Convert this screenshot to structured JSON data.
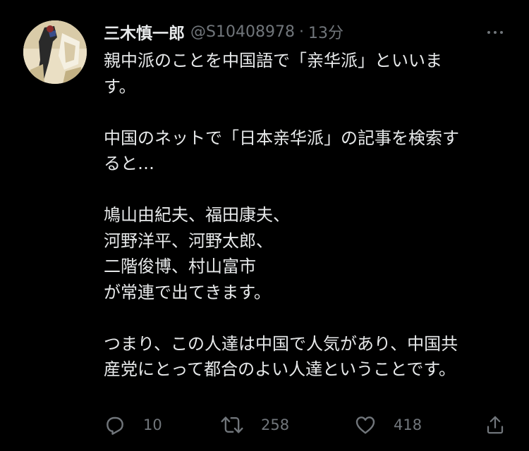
{
  "tweet": {
    "display_name": "三木慎一郎",
    "handle": "@S10408978",
    "separator": "·",
    "time": "13分",
    "more_icon": "more-horizontal-icon",
    "lines": [
      "親中派のことを中国語で「亲华派」といいま",
      "す。",
      "",
      "中国のネットで「日本亲华派」の記事を検索す",
      "ると…",
      "",
      "鳩山由紀夫、福田康夫、",
      "河野洋平、河野太郎、",
      "二階俊博、村山富市",
      "が常連で出てきます。",
      "",
      "つまり、この人達は中国で人気があり、中国共",
      "産党にとって都合のよい人達ということです。"
    ],
    "actions": {
      "reply": {
        "icon": "reply-icon",
        "count": "10"
      },
      "retweet": {
        "icon": "retweet-icon",
        "count": "258"
      },
      "like": {
        "icon": "heart-icon",
        "count": "418"
      },
      "share": {
        "icon": "share-icon",
        "count": ""
      }
    }
  },
  "colors": {
    "background": "#000000",
    "primary_text": "#e7e9ea",
    "secondary_text": "#71767b"
  }
}
